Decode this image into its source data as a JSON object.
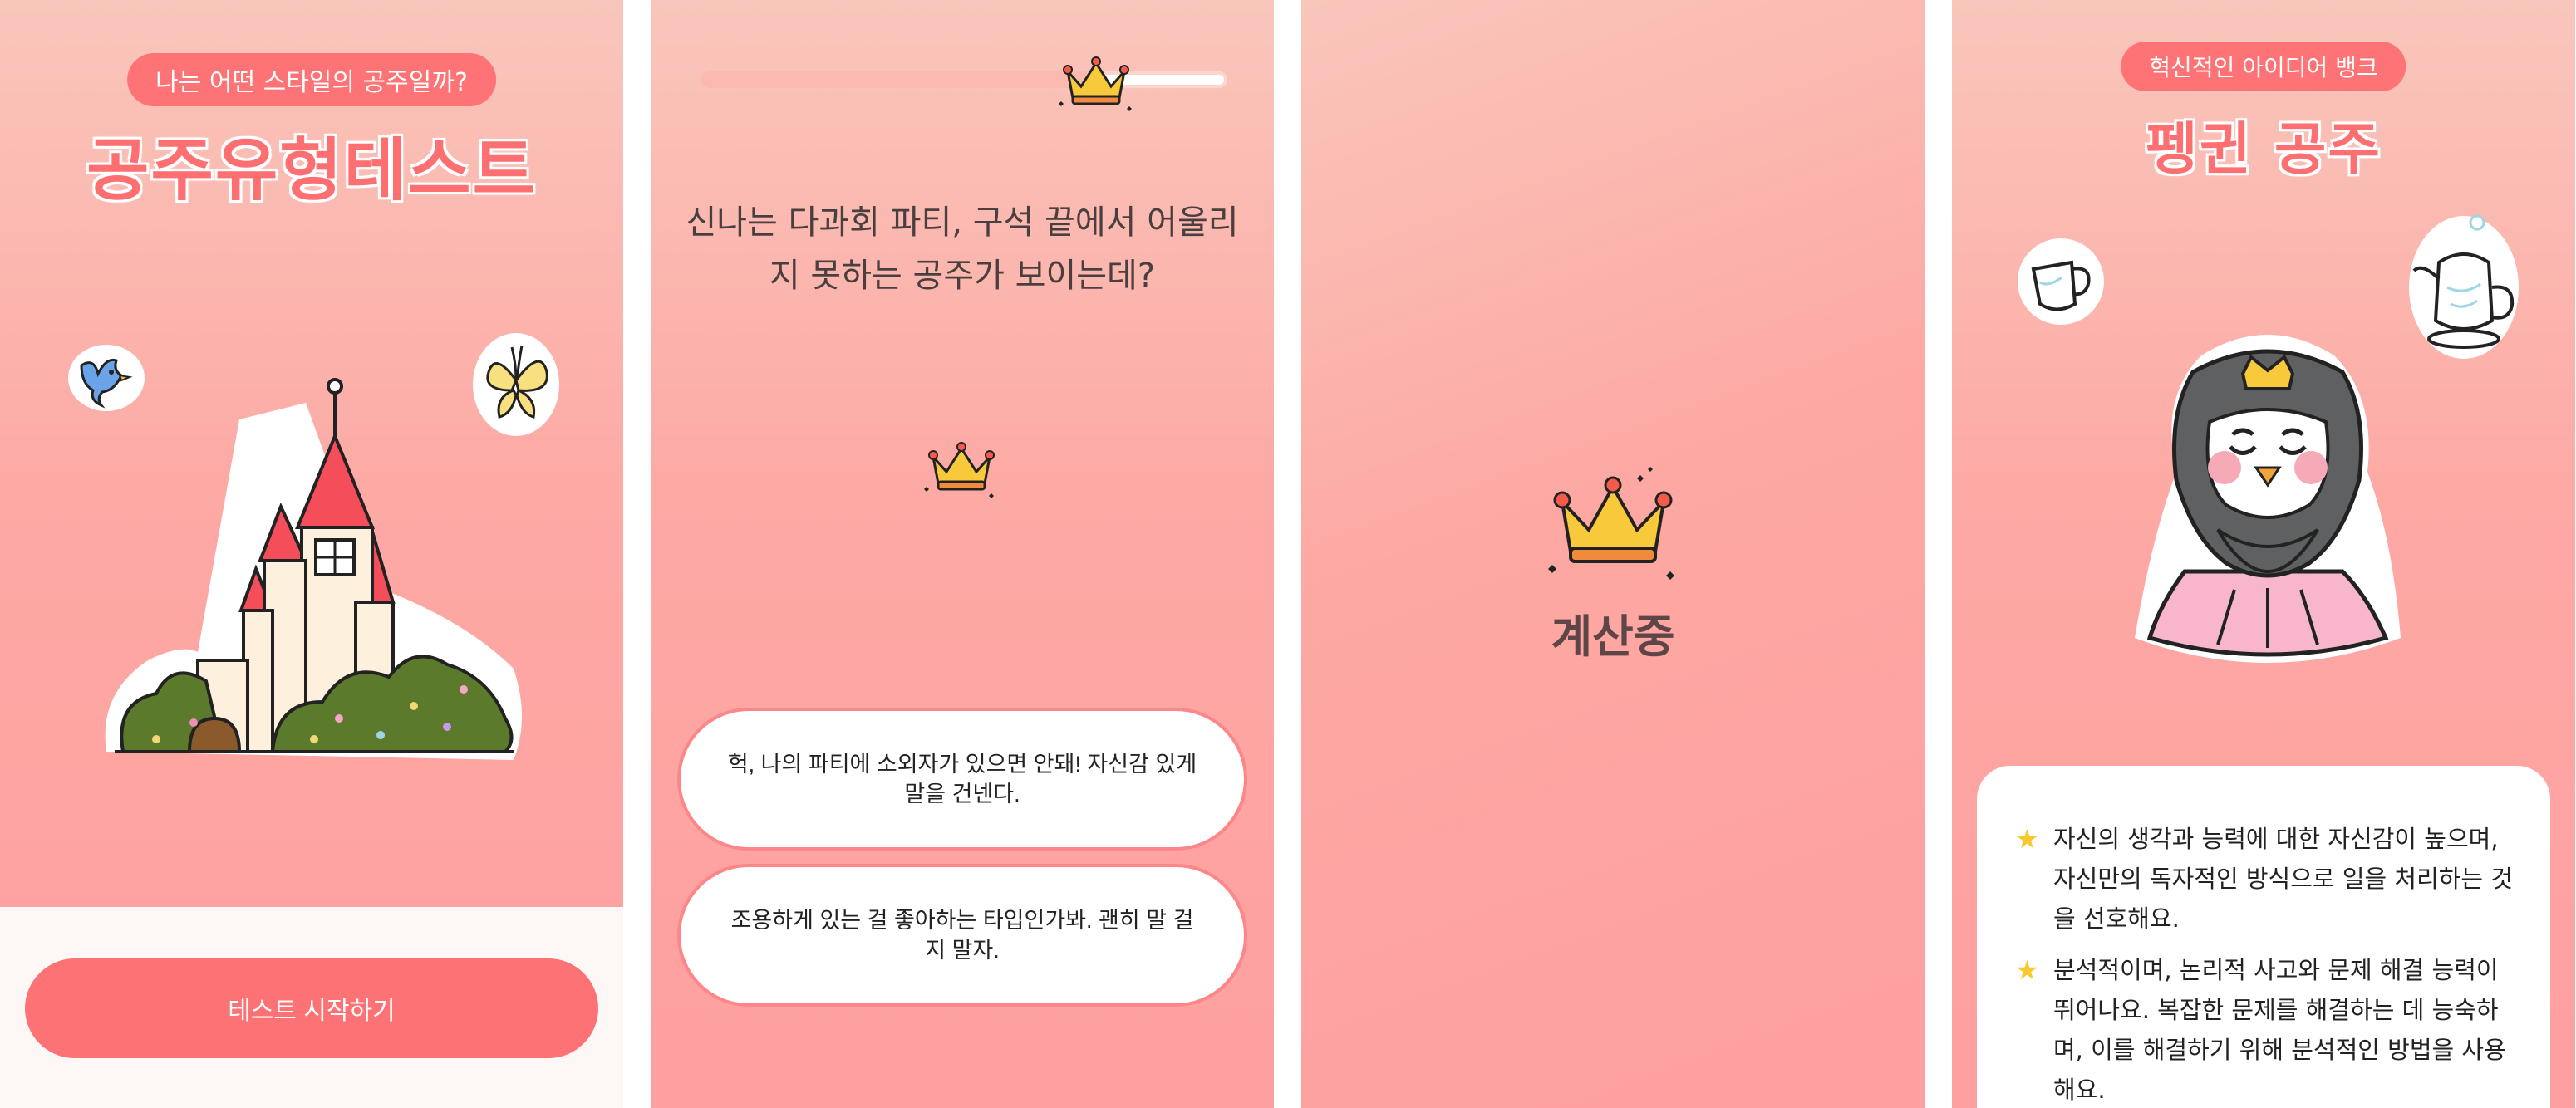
{
  "start_screen": {
    "subtitle": "나는 어떤 스타일의 공주일까?",
    "title": "공주유형테스트",
    "start_button": "테스트 시작하기"
  },
  "question_screen": {
    "progress_fraction": 0.75,
    "question": "신나는 다과회 파티, 구석 끝에서 어울리지 못하는 공주가 보이는데?",
    "answers": [
      "헉, 나의 파티에 소외자가 있으면 안돼! 자신감 있게 말을 건넨다.",
      "조용하게 있는 걸 좋아하는 타입인가봐. 괜히 말 걸지 말자."
    ]
  },
  "loading_screen": {
    "text": "계산중"
  },
  "result_screen": {
    "subtitle": "혁신적인 아이디어 뱅크",
    "title": "펭귄 공주",
    "descriptions": [
      "자신의 생각과 능력에 대한 자신감이 높으며, 자신만의 독자적인 방식으로 일을 처리하는 것을 선호해요.",
      "분석적이며, 논리적 사고와 문제 해결 능력이 뛰어나요. 복잡한 문제를 해결하는 데 능숙하며, 이를 해결하기 위해 분석적인 방법을 사용해요."
    ]
  },
  "colors": {
    "accent": "#fd7274",
    "title": "#fe6f72",
    "background_top": "#f9c6bb",
    "background_bottom": "#fe9fa0"
  },
  "icons": [
    "castle-icon",
    "bird-icon",
    "butterfly-icon",
    "crown-icon",
    "teacup-icon",
    "teapot-icon",
    "penguin-icon",
    "star-icon"
  ]
}
